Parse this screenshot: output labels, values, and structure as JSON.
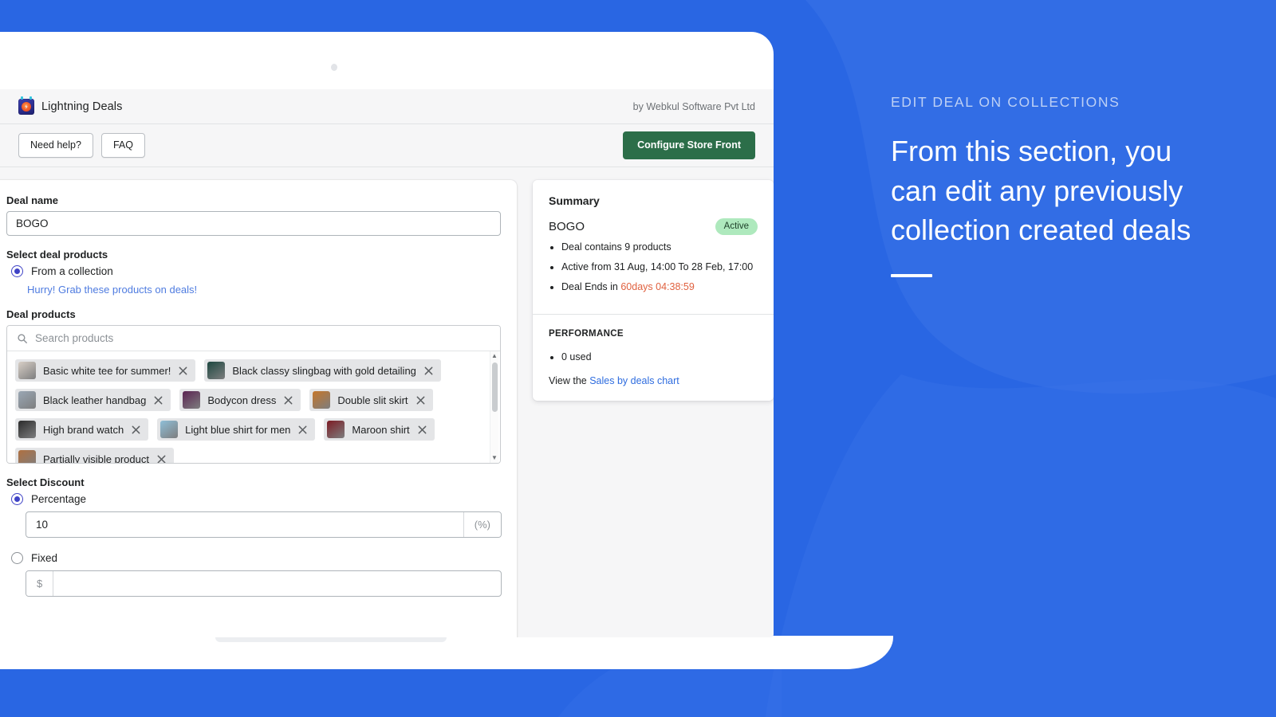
{
  "theme": {
    "background_blue": "#2966e3",
    "blob_blue": "#3a72e8",
    "primary_button_green": "#2c6e49",
    "badge_green": "#aee9bd",
    "link_blue": "#2e6cdf",
    "timer_red": "#e0613f",
    "radio_indigo": "#3f43c6"
  },
  "app": {
    "brand_name": "Lightning Deals",
    "brand_icon": "lightning-app-icon",
    "by_line": "by Webkul Software Pvt Ltd",
    "actions": {
      "need_help": "Need help?",
      "faq": "FAQ",
      "configure": "Configure Store Front"
    }
  },
  "form": {
    "deal_name_label": "Deal name",
    "deal_name_value": "BOGO",
    "select_deal_products_label": "Select deal products",
    "from_collection_label": "From a collection",
    "from_collection_selected": true,
    "hurry_link": "Hurry! Grab these products on deals!",
    "deal_products_label": "Deal products",
    "search_placeholder": "Search products",
    "search_value": "",
    "search_icon": "search-icon",
    "products": [
      {
        "name": "Basic white tee for summer!",
        "thumb": "#d8cfc6"
      },
      {
        "name": "Black classy slingbag with gold detailing",
        "thumb": "#1d4740"
      },
      {
        "name": "Black leather handbag",
        "thumb": "#9aa7b4"
      },
      {
        "name": "Bodycon dress",
        "thumb": "#5b2352"
      },
      {
        "name": "Double slit skirt",
        "thumb": "#c5762a"
      },
      {
        "name": "High brand watch",
        "thumb": "#2b2b2b"
      },
      {
        "name": "Light blue shirt for men",
        "thumb": "#8fbfd8"
      },
      {
        "name": "Maroon shirt",
        "thumb": "#7d1c24"
      },
      {
        "name": "Partially visible product",
        "thumb": "#b07040"
      }
    ],
    "remove_icon": "close-icon",
    "select_discount_label": "Select Discount",
    "percentage_label": "Percentage",
    "percentage_selected": true,
    "percentage_value": "10",
    "percentage_suffix": "(%)",
    "fixed_label": "Fixed",
    "fixed_selected": false,
    "fixed_value": "",
    "fixed_prefix": "$"
  },
  "summary": {
    "title": "Summary",
    "deal_name": "BOGO",
    "status_badge": "Active",
    "bullets": [
      "Deal contains 9 products",
      "Active from 31 Aug, 14:00 To 28 Feb, 17:00"
    ],
    "ends_prefix": "Deal Ends in ",
    "ends_timer": "60days 04:38:59",
    "performance_title": "PERFORMANCE",
    "performance_bullets": [
      "0 used"
    ],
    "footer_prefix": "View the ",
    "footer_link": "Sales by deals chart"
  },
  "promo": {
    "eyebrow": "EDIT DEAL ON COLLECTIONS",
    "headline": "From this section, you can edit any previously collection created deals"
  }
}
